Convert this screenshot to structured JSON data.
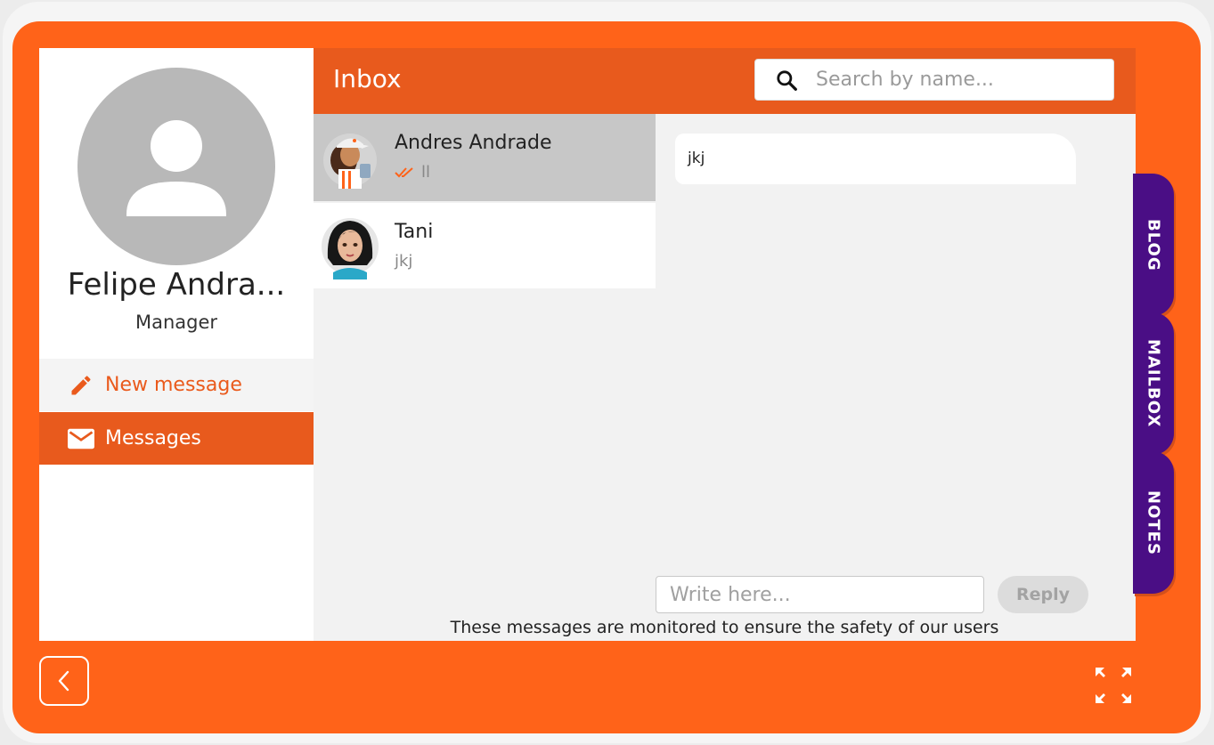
{
  "profile": {
    "name": "Felipe Andra...",
    "role": "Manager"
  },
  "menu": {
    "new_message": "New message",
    "messages": "Messages"
  },
  "header": {
    "title": "Inbox",
    "search_placeholder": "Search by name..."
  },
  "conversations": [
    {
      "name": "Andres Andrade",
      "preview": "ll",
      "selected": true
    },
    {
      "name": "Tani",
      "preview": "jkj",
      "selected": false
    }
  ],
  "chat": {
    "message": "jkj",
    "input_placeholder": "Write here...",
    "reply_label": "Reply",
    "notice": "These messages are monitored to ensure the safety of our users"
  },
  "tabs": [
    "BLOG",
    "MAILBOX",
    "NOTES"
  ],
  "colors": {
    "frame": "#ff6319",
    "accent": "#e85a1d",
    "tab": "#4a0e85"
  }
}
